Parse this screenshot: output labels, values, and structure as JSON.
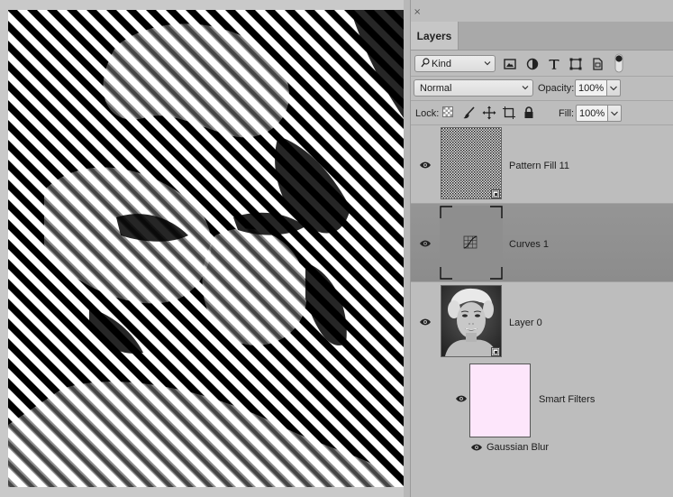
{
  "panel": {
    "close_glyph": "×",
    "tab_label": "Layers"
  },
  "filter": {
    "kind_label": "Kind",
    "icons": [
      "image-filter-icon",
      "adjustment-filter-icon",
      "type-filter-icon",
      "shape-filter-icon",
      "smart-object-filter-icon",
      "filter-toggle-icon"
    ]
  },
  "blend": {
    "mode_label": "Normal",
    "opacity_label": "Opacity:",
    "opacity_value": "100%"
  },
  "lock": {
    "label": "Lock:",
    "icons": [
      "lock-transparent-icon",
      "lock-image-icon",
      "lock-position-icon",
      "lock-artboard-icon",
      "lock-all-icon"
    ],
    "fill_label": "Fill:",
    "fill_value": "100%"
  },
  "layers": [
    {
      "name": "Pattern Fill 11",
      "visible": true,
      "selected": false
    },
    {
      "name": "Curves 1",
      "visible": true,
      "selected": true
    },
    {
      "name": "Layer 0",
      "visible": true,
      "selected": false
    },
    {
      "name": "Smart Filters",
      "visible": true,
      "selected": false
    },
    {
      "name": "Gaussian Blur",
      "visible": true,
      "selected": false
    }
  ],
  "colors": {
    "panel_bg": "#bdbdbd",
    "selected_row": "#909090",
    "smart_filter_mask": "#fde6fb",
    "canvas_bg": "#c9c9c9"
  }
}
